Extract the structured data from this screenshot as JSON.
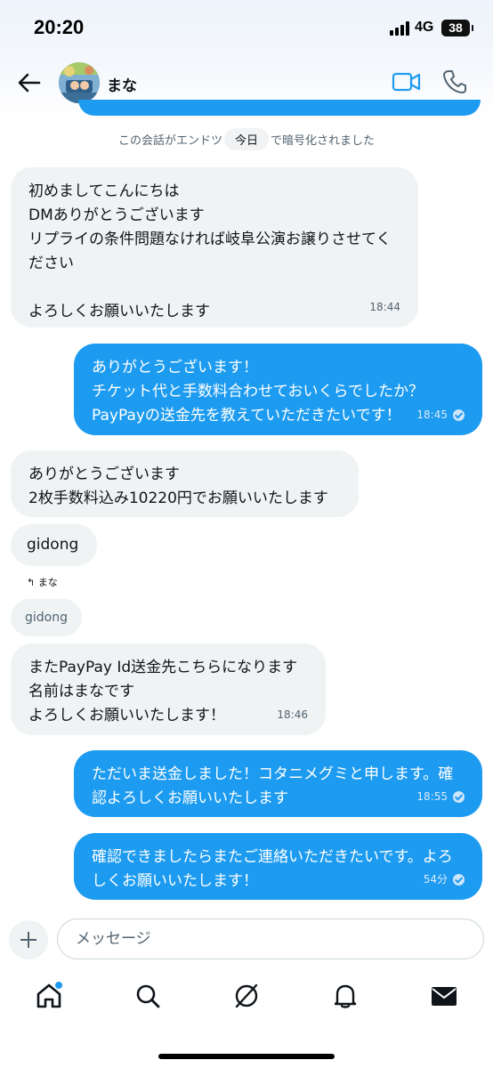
{
  "status_bar": {
    "time": "20:20",
    "network": "4G",
    "battery": "38"
  },
  "header": {
    "contact_name": "まな",
    "back_icon": "back-arrow-icon",
    "video_icon": "video-camera-icon",
    "call_icon": "phone-icon"
  },
  "encryption_notice": {
    "before": "この会話がエンドツ",
    "pill": "今日",
    "after": "で暗号化されました"
  },
  "messages": [
    {
      "direction": "incoming",
      "text": "初めましてこんにちは\nDMありがとうございます\nリプライの条件問題なければ岐阜公演お譲りさせてください\n\nよろしくお願いいたします",
      "time": "18:44"
    },
    {
      "direction": "outgoing",
      "text": "ありがとうございます！\nチケット代と手数料合わせておいくらでしたか？\nPayPayの送金先を教えていただきたいです！",
      "time": "18:45",
      "read": true
    },
    {
      "direction": "incoming",
      "text": "ありがとうございます\n2枚手数料込み10220円でお願いいたします"
    },
    {
      "direction": "incoming",
      "text": "gidong"
    },
    {
      "direction": "incoming",
      "reply_to_label": "まな",
      "quoted_text": "gidong",
      "text": "またPayPay Id送金先こちらになります\n名前はまなです\nよろしくお願いいたします！",
      "time": "18:46"
    },
    {
      "direction": "outgoing",
      "text": "ただいま送金しました！コタニメグミと申します。確認よろしくお願いいたします",
      "time": "18:55",
      "read": true
    },
    {
      "direction": "outgoing",
      "text": "確認できましたらまたご連絡いただきたいです。よろしくお願いいたします！",
      "time": "54分",
      "read": true
    }
  ],
  "composer": {
    "placeholder": "メッセージ"
  },
  "tab_bar": {
    "items": [
      "home-icon",
      "search-icon",
      "grok-icon",
      "notifications-bell-icon",
      "messages-envelope-icon"
    ],
    "active": "home-icon"
  },
  "colors": {
    "accent": "#1d9bf0",
    "incoming_bubble": "#eff3f4",
    "text": "#0f1419",
    "muted": "#536471"
  }
}
